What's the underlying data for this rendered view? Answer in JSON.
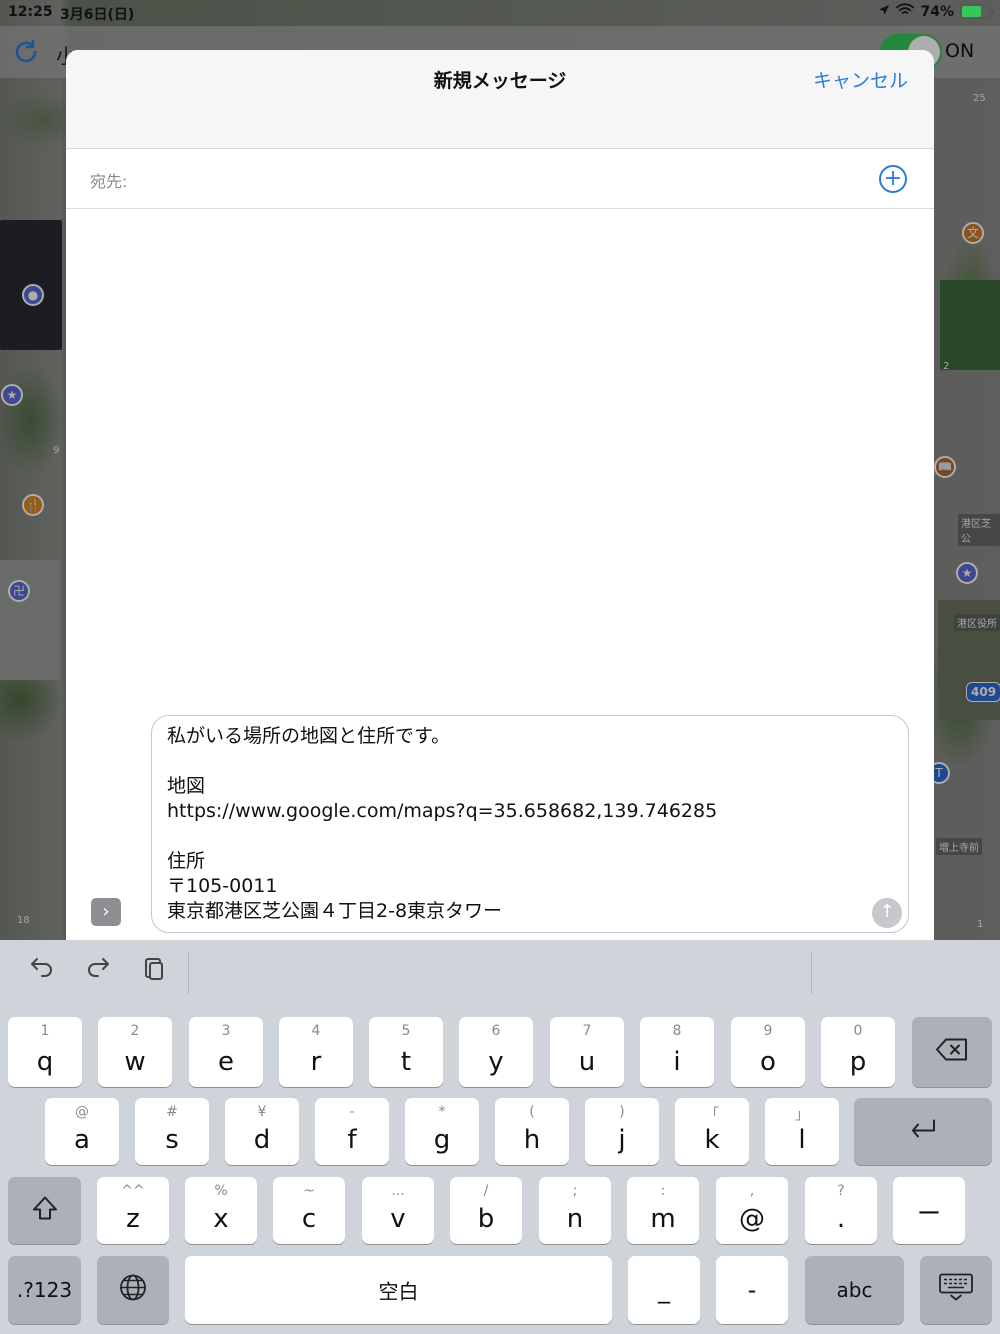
{
  "status_bar": {
    "time": "12:25",
    "date": "3月6日(日)",
    "battery": "74%"
  },
  "app_toolbar": {
    "title_fragment": "小",
    "toggle_label": "ON"
  },
  "map_labels": {
    "shiba_koen": "港区芝公",
    "minato_office": "港区役所",
    "zojoji_mae": "増上寺前",
    "route_409": "409",
    "num_25": "25",
    "num_2a": "2",
    "num_9": "9",
    "num_18": "18",
    "num_1": "1"
  },
  "compose": {
    "title": "新規メッセージ",
    "cancel_label": "キャンセル",
    "to_label": "宛先:",
    "to_value": "",
    "message_lines": [
      "私がいる場所の地図と住所です。",
      "",
      "地図",
      "https://www.google.com/maps?q=35.658682,139.746285",
      "",
      "住所",
      "〒105-0011",
      "東京都港区芝公園４丁目2-8東京タワー"
    ]
  },
  "keyboard": {
    "row1": [
      {
        "sub": "1",
        "main": "q"
      },
      {
        "sub": "2",
        "main": "w"
      },
      {
        "sub": "3",
        "main": "e"
      },
      {
        "sub": "4",
        "main": "r"
      },
      {
        "sub": "5",
        "main": "t"
      },
      {
        "sub": "6",
        "main": "y"
      },
      {
        "sub": "7",
        "main": "u"
      },
      {
        "sub": "8",
        "main": "i"
      },
      {
        "sub": "9",
        "main": "o"
      },
      {
        "sub": "0",
        "main": "p"
      }
    ],
    "row2": [
      {
        "sub": "@",
        "main": "a"
      },
      {
        "sub": "#",
        "main": "s"
      },
      {
        "sub": "¥",
        "main": "d"
      },
      {
        "sub": "-",
        "main": "f"
      },
      {
        "sub": "*",
        "main": "g"
      },
      {
        "sub": "(",
        "main": "h"
      },
      {
        "sub": ")",
        "main": "j"
      },
      {
        "sub": "「",
        "main": "k"
      },
      {
        "sub": "」",
        "main": "l"
      }
    ],
    "row3": [
      {
        "sub": "^^",
        "main": "z"
      },
      {
        "sub": "%",
        "main": "x"
      },
      {
        "sub": "~",
        "main": "c"
      },
      {
        "sub": "...",
        "main": "v"
      },
      {
        "sub": "/",
        "main": "b"
      },
      {
        "sub": ";",
        "main": "n"
      },
      {
        "sub": ":",
        "main": "m"
      },
      {
        "sub": ",",
        "main": "@"
      },
      {
        "sub": "?",
        "main": "."
      }
    ],
    "dash_key": "ー",
    "numbers_key": ".?123",
    "space_key": "空白",
    "underscore_key": "_",
    "hyphen_key": "-",
    "abc_key": "abc"
  }
}
